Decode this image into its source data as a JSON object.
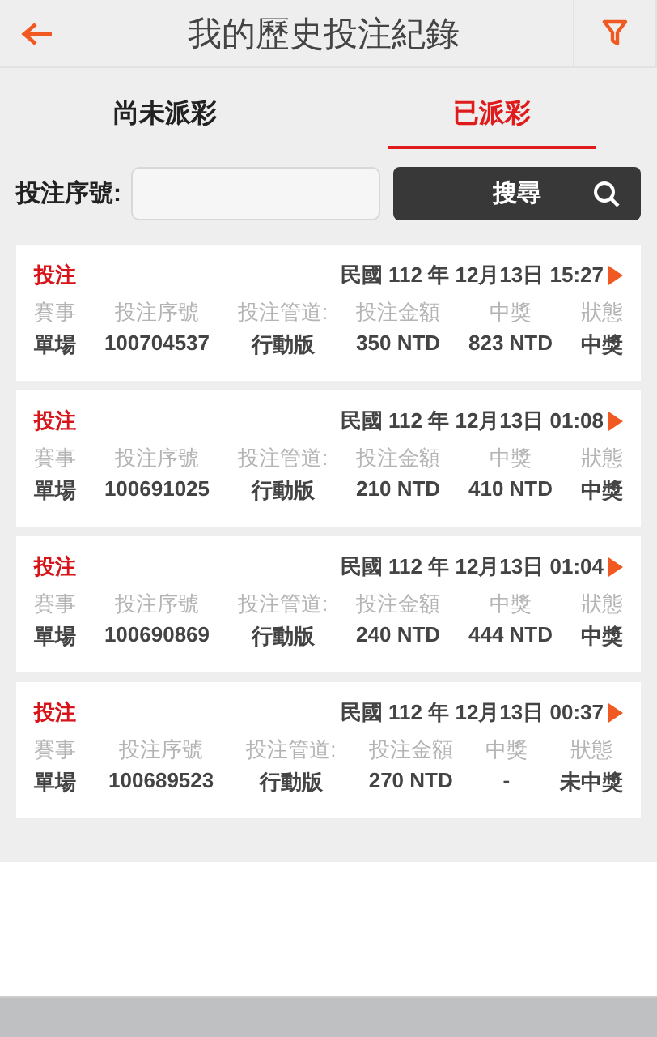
{
  "header": {
    "title": "我的歷史投注紀錄"
  },
  "tabs": [
    {
      "label": "尚未派彩",
      "selected": false
    },
    {
      "label": "已派彩",
      "selected": true
    }
  ],
  "search": {
    "label": "投注序號:",
    "button": "搜尋"
  },
  "records": [
    {
      "type": "投注",
      "datetime": "民國 112 年 12月13日 15:27",
      "columns": [
        "賽事",
        "投注序號",
        "投注管道:",
        "投注金額",
        "中獎",
        "狀態"
      ],
      "values": [
        "單場",
        "100704537",
        "行動版",
        "350 NTD",
        "823 NTD",
        "中獎"
      ]
    },
    {
      "type": "投注",
      "datetime": "民國 112 年 12月13日 01:08",
      "columns": [
        "賽事",
        "投注序號",
        "投注管道:",
        "投注金額",
        "中獎",
        "狀態"
      ],
      "values": [
        "單場",
        "100691025",
        "行動版",
        "210 NTD",
        "410 NTD",
        "中獎"
      ]
    },
    {
      "type": "投注",
      "datetime": "民國 112 年 12月13日 01:04",
      "columns": [
        "賽事",
        "投注序號",
        "投注管道:",
        "投注金額",
        "中獎",
        "狀態"
      ],
      "values": [
        "單場",
        "100690869",
        "行動版",
        "240 NTD",
        "444 NTD",
        "中獎"
      ]
    },
    {
      "type": "投注",
      "datetime": "民國 112 年 12月13日 00:37",
      "columns": [
        "賽事",
        "投注序號",
        "投注管道:",
        "投注金額",
        "中獎",
        "狀態"
      ],
      "values": [
        "單場",
        "100689523",
        "行動版",
        "270 NTD",
        "-",
        "未中獎"
      ]
    }
  ]
}
